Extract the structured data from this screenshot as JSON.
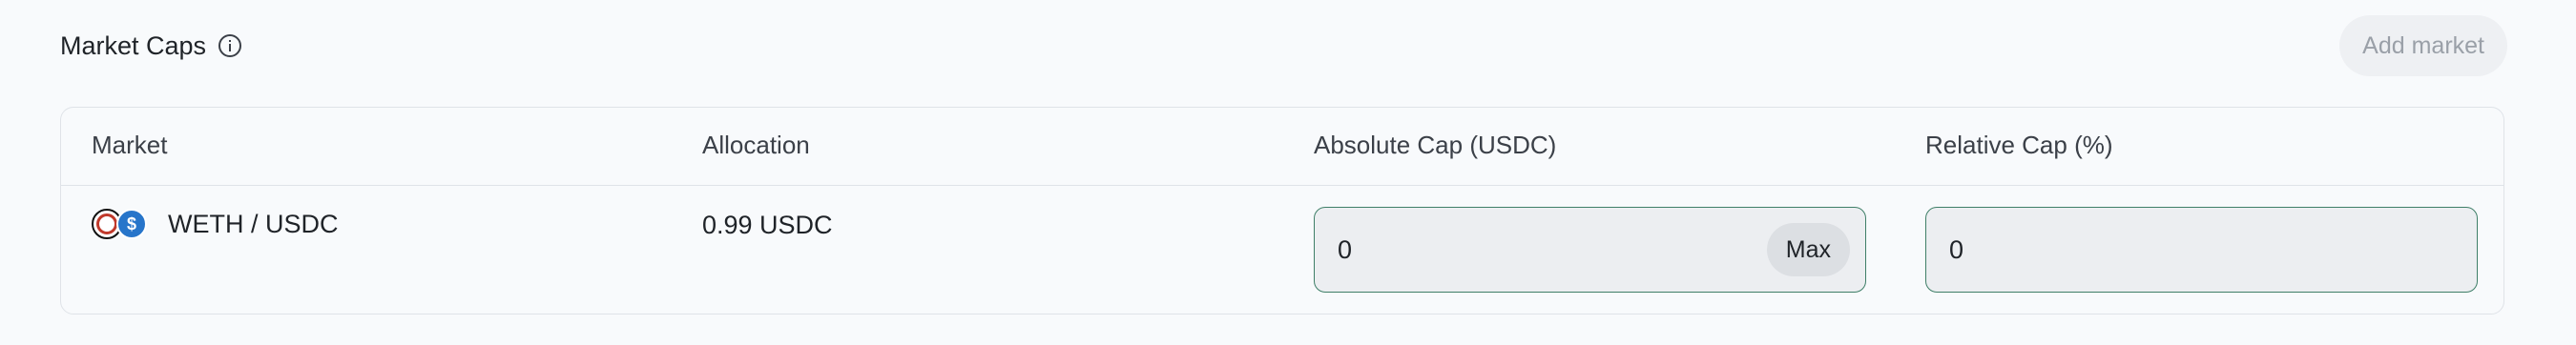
{
  "section": {
    "title": "Market Caps",
    "info_icon": "info-circle-icon",
    "add_market_label": "Add market"
  },
  "table": {
    "columns": [
      "Market",
      "Allocation",
      "Absolute Cap (USDC)",
      "Relative Cap (%)"
    ],
    "rows": [
      {
        "market": "WETH / USDC",
        "icons": [
          "weth-token-icon",
          "usdc-token-icon"
        ],
        "allocation": "0.99 USDC",
        "absolute_cap": "0",
        "max_label": "Max",
        "relative_cap": "0"
      }
    ]
  },
  "colors": {
    "background": "#f8fafc",
    "input_border": "#3f7f68",
    "usdc": "#2775ca"
  }
}
